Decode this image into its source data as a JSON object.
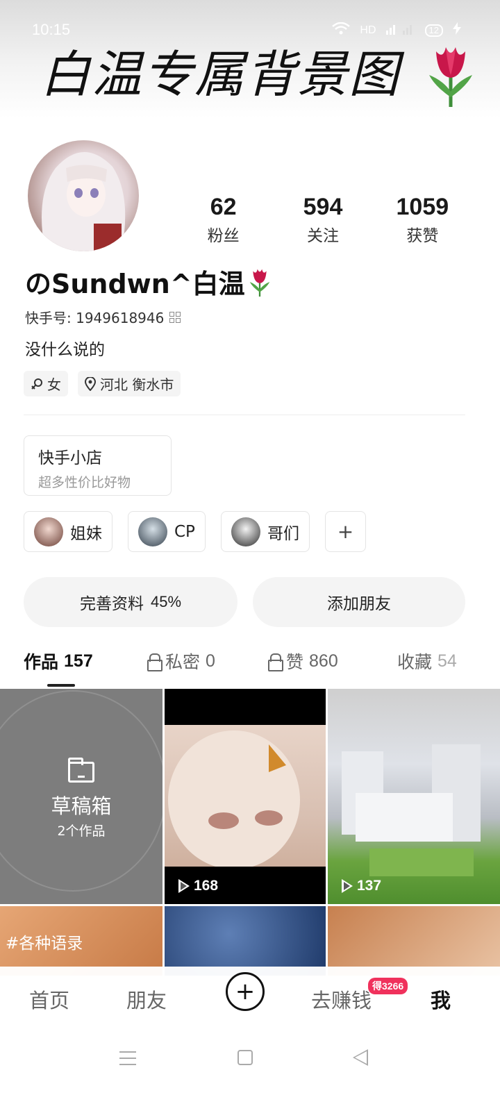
{
  "status_bar": {
    "time": "10:15",
    "network": "HD",
    "battery": "12"
  },
  "banner": {
    "title": "白温专属背景图"
  },
  "profile": {
    "stats": [
      {
        "value": "62",
        "label": "粉丝"
      },
      {
        "value": "594",
        "label": "关注"
      },
      {
        "value": "1059",
        "label": "获赞"
      }
    ],
    "username": "のSundwn^白温",
    "kuaishou_id": "快手号: 1949618946",
    "bio": "没什么说的",
    "tags": {
      "gender": "女",
      "location": "河北 衡水市"
    }
  },
  "shop": {
    "title": "快手小店",
    "subtitle": "超多性价比好物"
  },
  "groups": [
    {
      "label": "姐妹"
    },
    {
      "label": "CP"
    },
    {
      "label": "哥们"
    }
  ],
  "groups_add_label": "+",
  "actions": {
    "complete_profile": "完善资料",
    "complete_percent": "45%",
    "add_friend": "添加朋友"
  },
  "tabs": [
    {
      "label": "作品",
      "count": "157"
    },
    {
      "label": "私密",
      "count": "0"
    },
    {
      "label": "赞",
      "count": "860"
    },
    {
      "label": "收藏",
      "count": "54"
    }
  ],
  "grid": {
    "draft_title": "草稿箱",
    "draft_count": "2个作品",
    "video2_plays": "168",
    "video3_plays": "137",
    "cell4_tag": "#各种语录"
  },
  "bottom_nav": {
    "home": "首页",
    "friends": "朋友",
    "earn": "去赚钱",
    "earn_badge": "得3266",
    "me": "我"
  }
}
